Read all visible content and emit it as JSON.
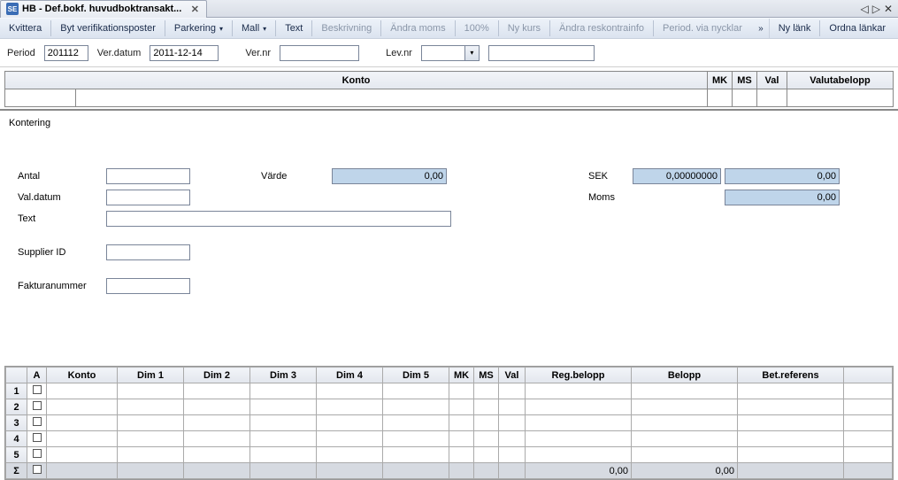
{
  "tab": {
    "icon_text": "SE",
    "title": "HB - Def.bokf. huvudboktransakt..."
  },
  "tabcontrols": {
    "prev": "◁",
    "next": "▷",
    "close": "✕"
  },
  "toolbar": {
    "kvittera": "Kvittera",
    "bytver": "Byt verifikationsposter",
    "parkering": "Parkering",
    "mall": "Mall",
    "text": "Text",
    "beskrivning": "Beskrivning",
    "andramoms": "Ändra moms",
    "p100": "100%",
    "nykurs": "Ny kurs",
    "andrareskontra": "Ändra reskontrainfo",
    "periodvia": "Period. via nycklar",
    "chev": "»",
    "nylank": "Ny länk",
    "ordnalankar": "Ordna länkar"
  },
  "filters": {
    "period_label": "Period",
    "period_value": "201112",
    "verdatum_label": "Ver.datum",
    "verdatum_value": "2011-12-14",
    "vernr_label": "Ver.nr",
    "vernr_value": "",
    "levnr_label": "Lev.nr",
    "levnr_value": "",
    "levnr_extra": ""
  },
  "upper_headers": {
    "konto": "Konto",
    "mk": "MK",
    "ms": "MS",
    "val": "Val",
    "valutabelopp": "Valutabelopp"
  },
  "section": {
    "kontering": "Kontering"
  },
  "kont": {
    "antal_label": "Antal",
    "antal_value": "",
    "varde_label": "Värde",
    "varde_value": "0,00",
    "sek_label": "SEK",
    "sek_rate": "0,00000000",
    "sek_amount": "0,00",
    "valdatum_label": "Val.datum",
    "valdatum_value": "",
    "moms_label": "Moms",
    "moms_value": "0,00",
    "text_label": "Text",
    "text_value": "",
    "supplier_label": "Supplier ID",
    "supplier_value": "",
    "fakturanr_label": "Fakturanummer",
    "fakturanr_value": ""
  },
  "grid": {
    "headers": {
      "a": "A",
      "konto": "Konto",
      "dim1": "Dim 1",
      "dim2": "Dim 2",
      "dim3": "Dim 3",
      "dim4": "Dim 4",
      "dim5": "Dim 5",
      "mk": "MK",
      "ms": "MS",
      "val": "Val",
      "regbelopp": "Reg.belopp",
      "belopp": "Belopp",
      "betref": "Bet.referens"
    },
    "rows": [
      "1",
      "2",
      "3",
      "4",
      "5"
    ],
    "sum_symbol": "Σ",
    "sum_reg": "0,00",
    "sum_belopp": "0,00"
  }
}
